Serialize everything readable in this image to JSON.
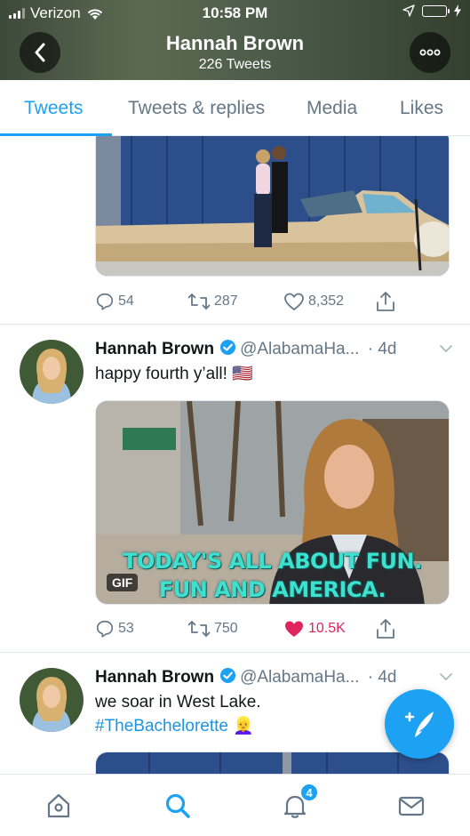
{
  "status_bar": {
    "carrier": "Verizon",
    "time": "10:58 PM",
    "battery_color": "#4cd964"
  },
  "header": {
    "name": "Hannah Brown",
    "tweet_count": "226 Tweets",
    "back_icon": "chevron-left-icon",
    "more_icon": "more-horizontal-icon"
  },
  "tabs": [
    {
      "label": "Tweets",
      "active": true
    },
    {
      "label": "Tweets & replies",
      "active": false
    },
    {
      "label": "Media",
      "active": false
    },
    {
      "label": "Likes",
      "active": false
    }
  ],
  "tweets": [
    {
      "media": "photo",
      "actions": {
        "replies": "54",
        "retweets": "287",
        "likes": "8,352",
        "liked": false
      }
    },
    {
      "name": "Hannah Brown",
      "handle": "@AlabamaHa...",
      "time": "· 4d",
      "text": "happy fourth y’all!",
      "emoji": "🇺🇸",
      "media": "gif",
      "gif_label": "GIF",
      "caption_line1": "TODAY'S ALL ABOUT FUN.",
      "caption_line2": "FUN AND AMERICA.",
      "actions": {
        "replies": "53",
        "retweets": "750",
        "likes": "10.5K",
        "liked": true
      }
    },
    {
      "name": "Hannah Brown",
      "handle": "@AlabamaHa...",
      "time": "· 4d",
      "text": "we soar in West Lake.",
      "hashtag": "#TheBachelorette",
      "hashtag_emoji": "👱‍♀️",
      "media": "photo"
    }
  ],
  "fab": {
    "icon": "compose-tweet-icon"
  },
  "bottom_nav": {
    "items": [
      "home-icon",
      "search-icon",
      "notifications-icon",
      "messages-icon"
    ],
    "active": "search-icon",
    "notification_count": "4"
  },
  "colors": {
    "accent": "#1da1f2",
    "like": "#e0245e",
    "secondary_text": "#657786"
  }
}
